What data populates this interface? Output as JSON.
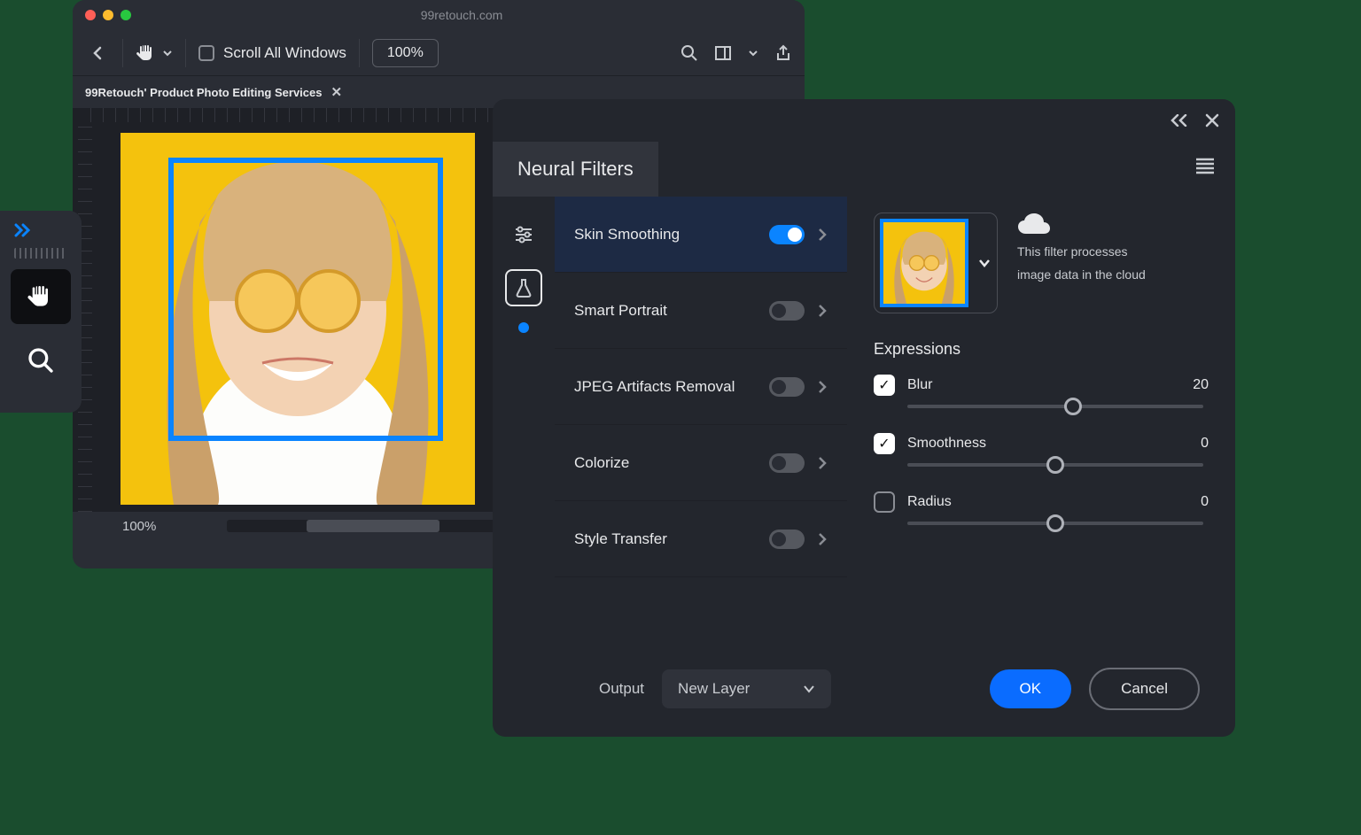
{
  "titlebar": {
    "url": "99retouch.com"
  },
  "toolbar": {
    "scroll_all_label": "Scroll All Windows",
    "zoom_value": "100%"
  },
  "tab": {
    "label": "99Retouch' Product Photo Editing Services"
  },
  "canvas": {
    "zoom_label": "100%"
  },
  "panel": {
    "title": "Neural Filters",
    "filters": [
      {
        "label": "Skin Smoothing",
        "on": true,
        "selected": true
      },
      {
        "label": "Smart Portrait",
        "on": false,
        "selected": false
      },
      {
        "label": "JPEG Artifacts Removal",
        "on": false,
        "selected": false
      },
      {
        "label": "Colorize",
        "on": false,
        "selected": false
      },
      {
        "label": "Style Transfer",
        "on": false,
        "selected": false
      }
    ],
    "cloud_info_line1": "This filter processes",
    "cloud_info_line2": "image data in the cloud",
    "section_title": "Expressions",
    "sliders": [
      {
        "label": "Blur",
        "value": 20,
        "checked": true,
        "pos": 56
      },
      {
        "label": "Smoothness",
        "value": 0,
        "checked": true,
        "pos": 50
      },
      {
        "label": "Radius",
        "value": 0,
        "checked": false,
        "pos": 50
      }
    ],
    "output_label": "Output",
    "output_value": "New Layer",
    "ok_label": "OK",
    "cancel_label": "Cancel"
  }
}
